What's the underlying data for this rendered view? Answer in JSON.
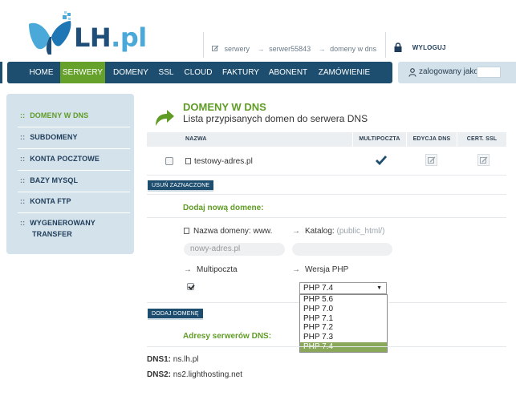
{
  "logo": {
    "text": "LH",
    "suffix": ".pl"
  },
  "breadcrumb": [
    {
      "label": "serwery"
    },
    {
      "label": "serwer55843"
    },
    {
      "label": "domeny w dns"
    }
  ],
  "logout": {
    "label": "WYLOGUJ"
  },
  "nav": {
    "items": [
      {
        "label": "HOME"
      },
      {
        "label": "SERWERY",
        "active": true
      },
      {
        "label": "DOMENY"
      },
      {
        "label": "SSL"
      },
      {
        "label": "CLOUD"
      },
      {
        "label": "FAKTURY"
      },
      {
        "label": "ABONENT"
      },
      {
        "label": "ZAMÓWIENIE"
      }
    ]
  },
  "user": {
    "label": "zalogowany jako:",
    "value": ""
  },
  "sidebar": {
    "items": [
      {
        "label": "DOMENY W DNS",
        "active": true
      },
      {
        "label": "SUBDOMENY"
      },
      {
        "label": "KONTA POCZTOWE"
      },
      {
        "label": "BAZY MYSQL"
      },
      {
        "label": "KONTA FTP"
      },
      {
        "label": "WYGENEROWANY",
        "label2": "TRANSFER"
      }
    ],
    "prefix": "::"
  },
  "page": {
    "title": "DOMENY W DNS",
    "subtitle": "Lista przypisanych domen do serwera DNS"
  },
  "table": {
    "headers": {
      "name": "NAZWA",
      "multi": "MULTIPOCZTA",
      "edit": "EDYCJA DNS",
      "cert": "CERT. SSL"
    },
    "rows": [
      {
        "name": "testowy-adres.pl",
        "multipoczta": true
      }
    ]
  },
  "buttons": {
    "delete_selected": "USUŃ ZAZNACZONE",
    "add_domain": "DODAJ DOMENĘ"
  },
  "add_form": {
    "title": "Dodaj nową domene:",
    "domain_label": "Nazwa domeny: www.",
    "domain_placeholder": "nowy-adres.pl",
    "catalog_label": "Katalog:",
    "catalog_hint": "(public_html/)",
    "catalog_value": "",
    "multi_label": "Multipoczta",
    "multi_checked": true,
    "php_label": "Wersja PHP",
    "php_selected": "PHP 7.4",
    "php_options": [
      "PHP 5.6",
      "PHP 7.0",
      "PHP 7.1",
      "PHP 7.2",
      "PHP 7.3",
      "PHP 7.4"
    ]
  },
  "dns": {
    "title": "Adresy serwerów DNS:",
    "dns1_label": "DNS1:",
    "dns1_value": "ns.lh.pl",
    "dns2_label": "DNS2:",
    "dns2_value": "ns2.lighthosting.net"
  },
  "colors": {
    "navy": "#1d4e6f",
    "green": "#65a12b",
    "sidebar_bg": "#d4e2eb"
  }
}
